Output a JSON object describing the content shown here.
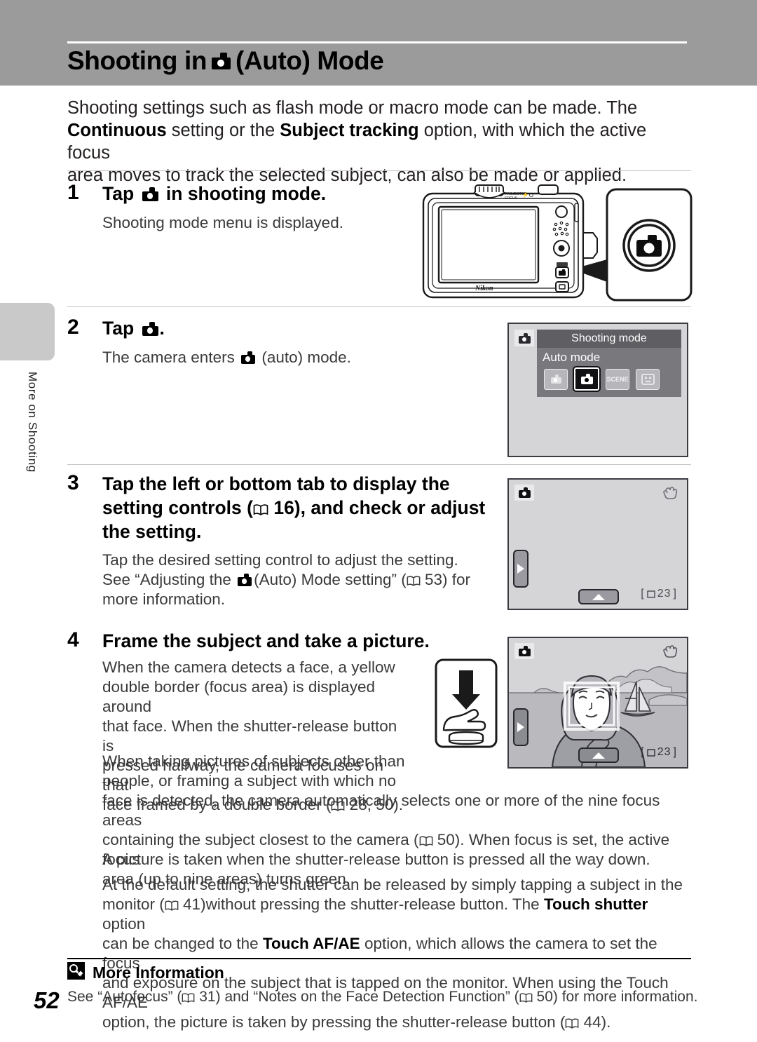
{
  "header": {
    "title_pre": "Shooting in",
    "title_post": "(Auto) Mode",
    "icon": "camera-icon"
  },
  "side_tab": {
    "label": "More on Shooting"
  },
  "intro": {
    "line1": "Shooting settings such as flash mode or macro mode can be made. The",
    "bold1": "Continuous",
    "mid1": " setting or the ",
    "bold2": "Subject tracking",
    "mid2": " option, with which the active focus",
    "line3": "area moves to track the selected subject, can also be made or applied."
  },
  "steps": [
    {
      "number": "1",
      "head_pre": "Tap",
      "head_post": "in shooting mode.",
      "body": "Shooting mode menu is displayed."
    },
    {
      "number": "2",
      "head_pre": "Tap",
      "head_post": ".",
      "body_pre": "The camera enters",
      "body_post": "(auto) mode."
    },
    {
      "number": "3",
      "head_line1": "Tap the left or bottom tab to display the",
      "head_line2_pre": "setting controls (",
      "head_line2_ref": "16),",
      "head_line2_post": "and check or adjust",
      "head_line3": "the setting.",
      "body_line1": "Tap the desired setting control to adjust the setting.",
      "body_line2_pre": "See “Adjusting the",
      "body_line2_mid": "(Auto) Mode setting” (",
      "body_line2_ref": "53)",
      "body_line2_post": "for",
      "body_line3": "more information."
    },
    {
      "number": "4",
      "head": "Frame the subject and take a picture.",
      "p1_l1": "When the camera detects a face, a yellow",
      "p1_l2": "double border (focus area) is displayed around",
      "p1_l3": "that face. When the shutter-release button is",
      "p1_l4": "pressed halfway, the camera focuses on that",
      "p1_l5_pre": "face framed by a double border (",
      "p1_l5_ref": "28, 50).",
      "p2_l1": "When taking pictures of subjects other than",
      "p2_l2": "people, or framing a subject with which no",
      "p2_l3": "face is detected, the camera automatically selects one or more of the nine focus areas",
      "p2_l4_pre": "containing the subject closest to the camera (",
      "p2_l4_ref": "50).",
      "p2_l4_post": "When focus is set, the active focus",
      "p2_l5": "area (up to nine areas) turns green.",
      "p3": "A picture is taken when the shutter-release button is pressed all the way down.",
      "p4_l1": "At the default setting, the shutter can be released by simply tapping a subject in the",
      "p4_l2_pre": "monitor (",
      "p4_l2_ref": "41)",
      "p4_l2_mid": "without pressing the shutter-release button. The ",
      "p4_l2_bold": "Touch shutter",
      "p4_l2_post": " option",
      "p4_l3_pre": "can be changed to the ",
      "p4_l3_bold": "Touch AF/AE",
      "p4_l3_post": " option, which allows the camera to set the focus",
      "p4_l4": "and exposure on the subject that is tapped on the monitor. When using the Touch AF/AE",
      "p4_l5_pre": "option, the picture is taken by pressing the shutter-release button (",
      "p4_l5_ref": "44)."
    }
  ],
  "screens": {
    "shooting_mode_menu": {
      "title": "Shooting mode",
      "selected_label": "Auto mode",
      "modes": [
        {
          "name": "easy-auto-mode",
          "glyph": "camera-heart"
        },
        {
          "name": "auto-mode",
          "glyph": "camera",
          "selected": true
        },
        {
          "name": "scene-mode",
          "glyph": "SCENE"
        },
        {
          "name": "smart-portrait-mode",
          "glyph": "smiley"
        }
      ]
    },
    "live_view_empty": {
      "mode_icon": "camera-icon",
      "vr_icon": "shake-reduction-icon",
      "left_tab": "left-setting-tab",
      "bottom_tab": "bottom-setting-tab",
      "counter": "23"
    },
    "live_view_scene": {
      "mode_icon": "camera-icon",
      "vr_icon": "shake-reduction-icon",
      "left_tab": "left-setting-tab",
      "bottom_tab": "bottom-setting-tab",
      "counter": "23"
    }
  },
  "camera_illustration": {
    "brand": "Nikon",
    "top_label_1": "PROJECTOR",
    "top_label_2": "FOCUS",
    "callout": "camera-mode-button"
  },
  "more_information": {
    "heading": "More Information",
    "icon": "more-information-icon",
    "body_pre": "See “Autofocus” (",
    "body_ref1": "31)",
    "body_mid": "and “Notes on the Face Detection Function” (",
    "body_ref2": "50)",
    "body_post": "for more information."
  },
  "page_number": "52",
  "colors": {
    "header_band": "#9b9b9b",
    "side_tab": "#c9c9c9",
    "screen_bg": "#d5d5d8",
    "screen_border": "#3b3b42",
    "titlebar": "#5f5f63"
  }
}
